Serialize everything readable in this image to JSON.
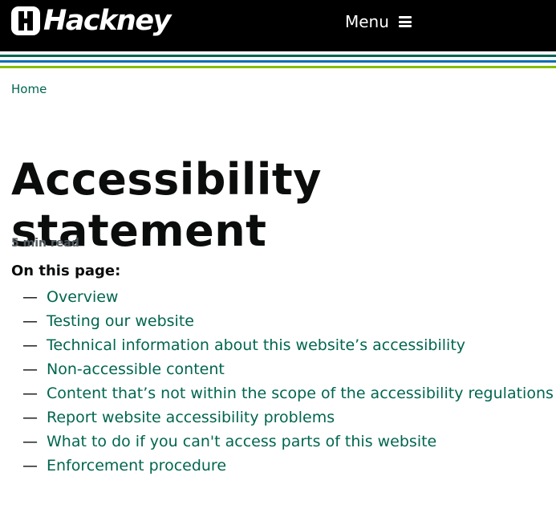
{
  "header": {
    "logo_text": "Hackney",
    "menu_label": "Menu"
  },
  "colors": {
    "header_bg": "#000000",
    "link": "#00664f",
    "stripe_dark_green": "#00664f",
    "stripe_blue": "#0b6fb2",
    "stripe_light_green": "#84bd00"
  },
  "icons": {
    "logo": "hackney-h-icon",
    "menu": "hamburger-icon"
  },
  "breadcrumb": {
    "home": "Home"
  },
  "page": {
    "title": "Accessibility statement",
    "read_time": "5 min read",
    "contents_heading": "On this page:",
    "contents": [
      "Overview",
      "Testing our website",
      "Technical information about this website’s accessibility",
      "Non-accessible content",
      "Content that’s not within the scope of the accessibility regulations",
      "Report website accessibility problems",
      "What to do if you can't access parts of this website",
      "Enforcement procedure"
    ]
  }
}
